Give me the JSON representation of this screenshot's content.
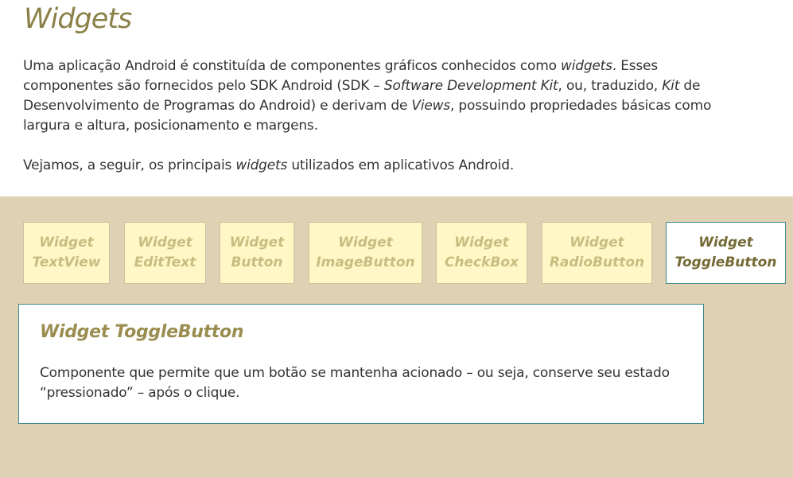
{
  "title": "Widgets",
  "intro": {
    "p1_a": "Uma aplicação Android é constituída de componentes gráficos conhecidos como ",
    "p1_b": "widgets",
    "p1_c": ". Esses componentes são fornecidos pelo SDK Android (SDK – ",
    "p1_d": "Software Development Kit",
    "p1_e": ", ou, traduzido, ",
    "p1_f": "Kit",
    "p1_g": " de Desenvolvimento de Programas do Android) e derivam de ",
    "p1_h": "Views",
    "p1_i": ", possuindo propriedades básicas como largura e altura, posicionamento e margens.",
    "p2_a": "Vejamos, a seguir, os principais ",
    "p2_b": "widgets",
    "p2_c": " utilizados em aplicativos Android."
  },
  "tabs": [
    {
      "line1": "Widget",
      "line2": "TextView"
    },
    {
      "line1": "Widget",
      "line2": "EditText"
    },
    {
      "line1": "Widget",
      "line2": "Button"
    },
    {
      "line1": "Widget",
      "line2": "ImageButton"
    },
    {
      "line1": "Widget",
      "line2": "CheckBox"
    },
    {
      "line1": "Widget",
      "line2": "RadioButton"
    },
    {
      "line1": "Widget",
      "line2": "ToggleButton"
    }
  ],
  "active_tab": "Widget ToggleButton",
  "panel": {
    "title": "Widget ToggleButton",
    "text": "Componente que permite que um botão se mantenha acionado – ou seja, conserve seu estado “pressionado” – após o clique."
  },
  "colors": {
    "accent_title": "#8b8148",
    "band": "#dfd1b3",
    "tab_bg": "#fff7c6",
    "tab_text": "#c8bc80",
    "active_border": "#3c8a8a"
  }
}
